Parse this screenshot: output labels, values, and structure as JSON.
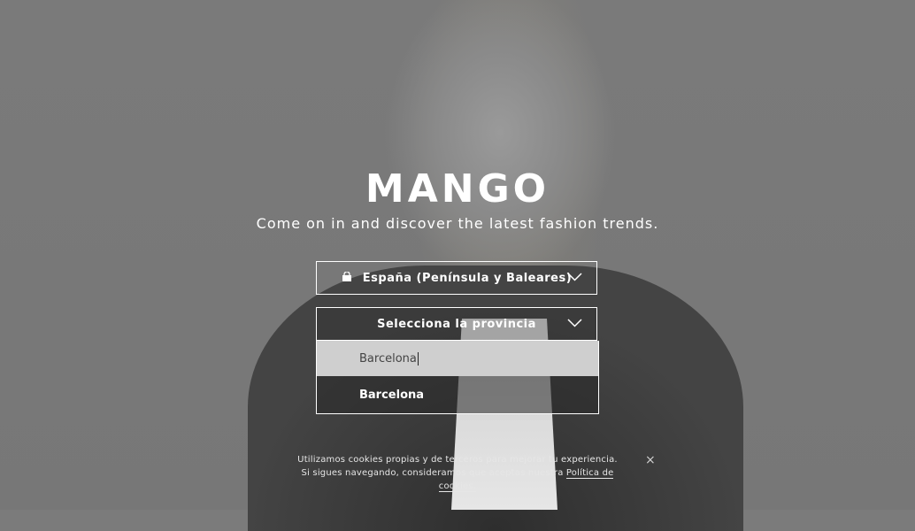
{
  "brand": {
    "logo": "MANGO",
    "tagline": "Come on in and discover the latest fashion trends."
  },
  "country_select": {
    "label": "España (Península y Baleares)",
    "icon": "shopping-bag-icon"
  },
  "province_select": {
    "label": "Selecciona la provincia"
  },
  "province_dropdown": {
    "search_value": "Barcelona",
    "options": [
      "Barcelona"
    ]
  },
  "cookie_notice": {
    "text_line1": "Utilizamos cookies propias y de terceros para mejorar tu experiencia.",
    "text_line2": "Si sigues navegando, consideramos que aceptas nuestra",
    "link": "Política de cookies.",
    "close_icon": "×"
  }
}
